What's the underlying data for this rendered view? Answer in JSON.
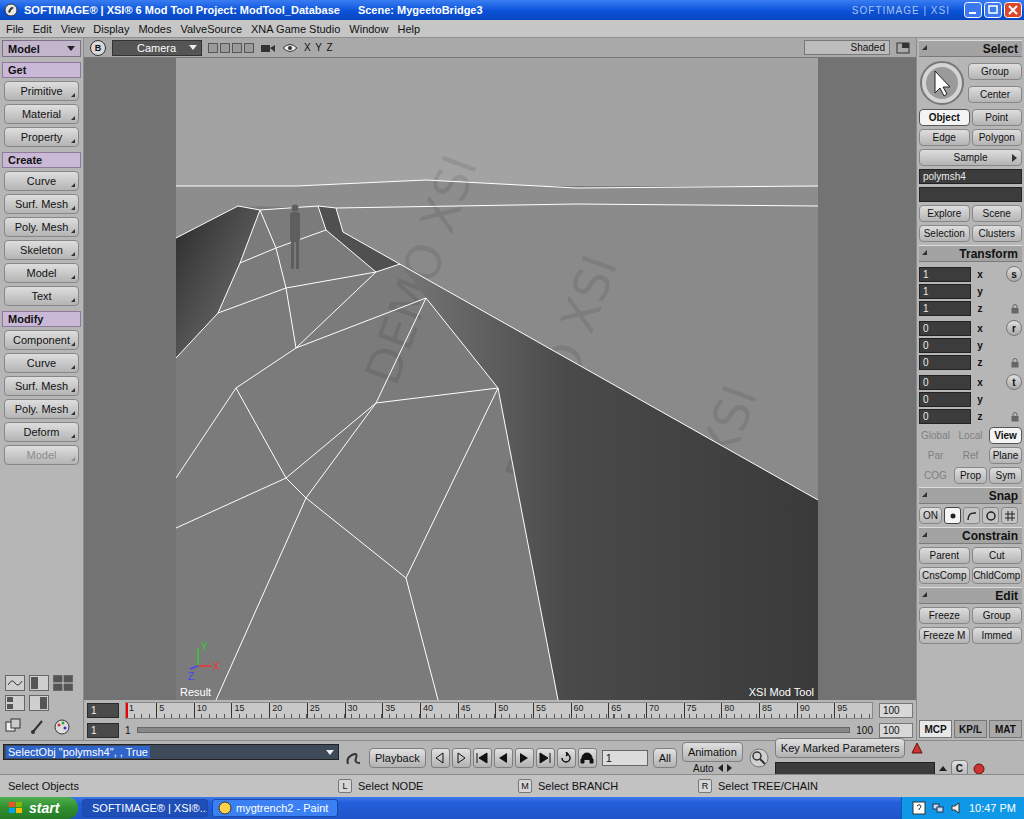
{
  "window": {
    "title": "SOFTIMAGE® | XSI® 6 Mod Tool Project: ModTool_Database",
    "scene": "Scene: MygeetoBridge3",
    "brand": "SOFTIMAGE | XSI"
  },
  "menu": [
    "File",
    "Edit",
    "View",
    "Display",
    "Modes",
    "ValveSource",
    "XNA Game Studio",
    "Window",
    "Help"
  ],
  "left_panel": {
    "mode": "Model",
    "sections": [
      {
        "title": "Get",
        "items": [
          {
            "label": "Primitive",
            "disabled": false
          },
          {
            "label": "Material",
            "disabled": false
          },
          {
            "label": "Property",
            "disabled": false
          }
        ]
      },
      {
        "title": "Create",
        "items": [
          {
            "label": "Curve",
            "disabled": false
          },
          {
            "label": "Surf. Mesh",
            "disabled": false
          },
          {
            "label": "Poly. Mesh",
            "disabled": false
          },
          {
            "label": "Skeleton",
            "disabled": false
          },
          {
            "label": "Model",
            "disabled": false
          },
          {
            "label": "Text",
            "disabled": false
          }
        ]
      },
      {
        "title": "Modify",
        "items": [
          {
            "label": "Component",
            "disabled": false
          },
          {
            "label": "Curve",
            "disabled": false
          },
          {
            "label": "Surf. Mesh",
            "disabled": false
          },
          {
            "label": "Poly. Mesh",
            "disabled": false
          },
          {
            "label": "Deform",
            "disabled": false
          },
          {
            "label": "Model",
            "disabled": true
          }
        ]
      }
    ]
  },
  "viewport": {
    "view": "B",
    "camera": "Camera",
    "axes": "X Y Z",
    "shading": "Shaded",
    "result_label": "Result",
    "product_label": "XSI Mod Tool",
    "watermark": "DEMO XSI",
    "axis_gizmo": {
      "x": "X",
      "y": "Y",
      "z": "Z"
    }
  },
  "select": {
    "title": "Select",
    "top_buttons": [
      "Group",
      "Center"
    ],
    "filters": [
      {
        "label": "Object",
        "selected": true
      },
      {
        "label": "Point",
        "selected": false
      },
      {
        "label": "Edge",
        "selected": false
      },
      {
        "label": "Polygon",
        "selected": false
      }
    ],
    "sample": "Sample",
    "selection": "polymsh4",
    "selection_2": "",
    "nav": [
      "Explore",
      "Scene",
      "Selection",
      "Clusters"
    ]
  },
  "transform": {
    "title": "Transform",
    "groups": [
      {
        "tool": "s",
        "values": [
          {
            "axis": "x",
            "value": "1"
          },
          {
            "axis": "y",
            "value": "1"
          },
          {
            "axis": "z",
            "value": "1"
          }
        ]
      },
      {
        "tool": "r",
        "values": [
          {
            "axis": "x",
            "value": "0"
          },
          {
            "axis": "y",
            "value": "0"
          },
          {
            "axis": "z",
            "value": "0"
          }
        ]
      },
      {
        "tool": "t",
        "values": [
          {
            "axis": "x",
            "value": "0"
          },
          {
            "axis": "y",
            "value": "0"
          },
          {
            "axis": "z",
            "value": "0"
          }
        ]
      }
    ],
    "options": [
      [
        {
          "label": "Global",
          "selected": false,
          "disabled": true
        },
        {
          "label": "Local",
          "selected": false,
          "disabled": true
        },
        {
          "label": "View",
          "selected": true,
          "disabled": false
        }
      ],
      [
        {
          "label": "Par",
          "selected": false,
          "disabled": true
        },
        {
          "label": "Ref",
          "selected": false,
          "disabled": true
        },
        {
          "label": "Plane",
          "selected": false,
          "disabled": false
        }
      ],
      [
        {
          "label": "COG",
          "selected": false,
          "disabled": true
        },
        {
          "label": "Prop",
          "selected": false,
          "disabled": false
        },
        {
          "label": "Sym",
          "selected": false,
          "disabled": false
        }
      ]
    ]
  },
  "snap": {
    "title": "Snap",
    "on": "ON",
    "modes": [
      {
        "kind": "point",
        "selected": true
      },
      {
        "kind": "curve",
        "selected": false
      },
      {
        "kind": "circle",
        "selected": false
      },
      {
        "kind": "grid",
        "selected": false
      }
    ]
  },
  "constrain": {
    "title": "Constrain",
    "buttons": [
      "Parent",
      "Cut",
      "CnsComp",
      "ChldComp"
    ]
  },
  "edit": {
    "title": "Edit",
    "buttons": [
      "Freeze",
      "Group",
      "Freeze M",
      "Immed"
    ]
  },
  "panel_tabs": [
    {
      "label": "MCP",
      "selected": true
    },
    {
      "label": "KP/L",
      "selected": false
    },
    {
      "label": "MAT",
      "selected": false
    }
  ],
  "timeline": {
    "current_frame": "1",
    "ticks": [
      "1",
      "5",
      "10",
      "15",
      "20",
      "25",
      "30",
      "35",
      "40",
      "45",
      "50",
      "55",
      "60",
      "65",
      "70",
      "75",
      "80",
      "85",
      "90",
      "95"
    ],
    "playhead": 0,
    "end_frame": "100",
    "range_start": "1",
    "range_start_label": "1",
    "range_end_label": "100",
    "range_end": "100"
  },
  "command": {
    "line": "SelectObj \"polymsh4\", , True",
    "playback": "Playback",
    "frame": "1",
    "all": "All",
    "animation": "Animation",
    "auto": "Auto",
    "key_marked": "Key Marked Parameters",
    "key_field": "",
    "clear": "C"
  },
  "status": {
    "message": "Select Objects",
    "mouse": [
      {
        "button": "L",
        "action": "Select NODE"
      },
      {
        "button": "M",
        "action": "Select BRANCH"
      },
      {
        "button": "R",
        "action": "Select TREE/CHAIN"
      }
    ]
  },
  "taskbar": {
    "start": "start",
    "tasks": [
      {
        "label": "SOFTIMAGE® | XSI®...",
        "active": true
      },
      {
        "label": "mygtrench2 - Paint",
        "active": false
      }
    ],
    "clock": "10:47 PM"
  }
}
